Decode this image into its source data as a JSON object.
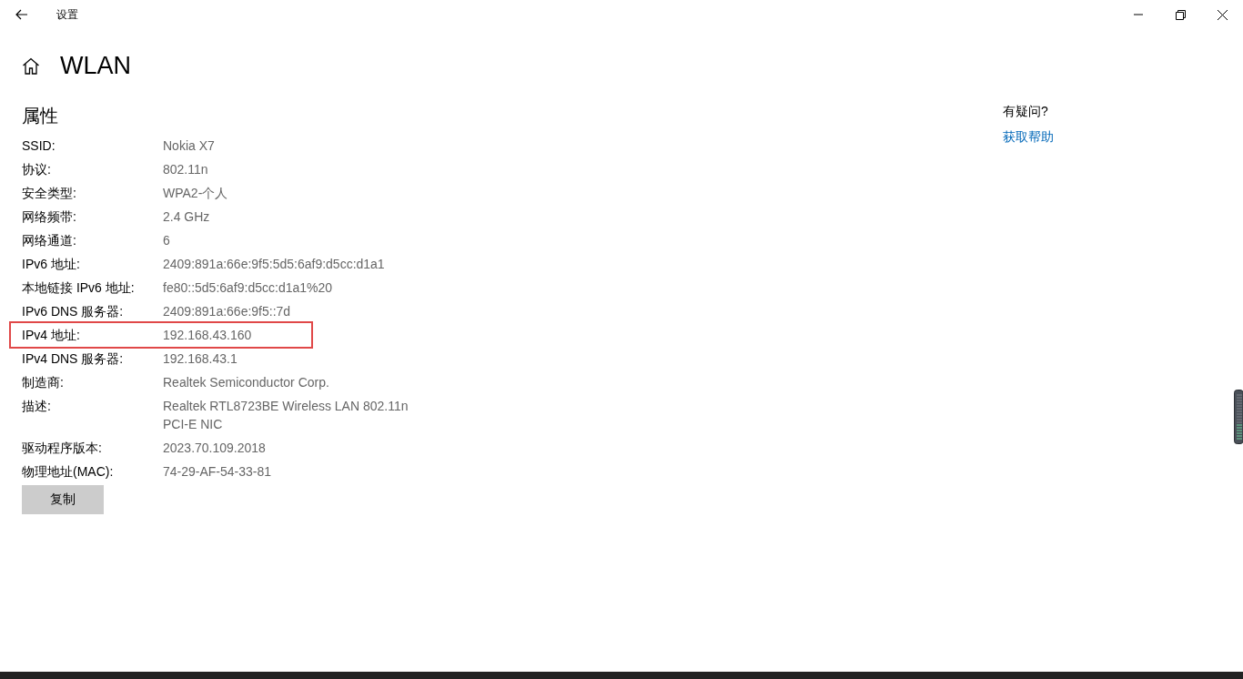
{
  "window": {
    "title": "设置"
  },
  "page": {
    "title": "WLAN"
  },
  "section": {
    "title": "属性"
  },
  "properties": [
    {
      "label": "SSID:",
      "value": [
        "Nokia X7"
      ],
      "highlighted": false
    },
    {
      "label": "协议:",
      "value": [
        "802.11n"
      ],
      "highlighted": false
    },
    {
      "label": "安全类型:",
      "value": [
        "WPA2-个人"
      ],
      "highlighted": false
    },
    {
      "label": "网络频带:",
      "value": [
        "2.4 GHz"
      ],
      "highlighted": false
    },
    {
      "label": "网络通道:",
      "value": [
        "6"
      ],
      "highlighted": false
    },
    {
      "label": "IPv6 地址:",
      "value": [
        "2409:891a:66e:9f5:5d5:6af9:d5cc:d1a1"
      ],
      "highlighted": false
    },
    {
      "label": "本地链接 IPv6 地址:",
      "value": [
        "fe80::5d5:6af9:d5cc:d1a1%20"
      ],
      "highlighted": false
    },
    {
      "label": "IPv6 DNS 服务器:",
      "value": [
        "2409:891a:66e:9f5::7d"
      ],
      "highlighted": false
    },
    {
      "label": "IPv4 地址:",
      "value": [
        "192.168.43.160"
      ],
      "highlighted": true
    },
    {
      "label": "IPv4 DNS 服务器:",
      "value": [
        "192.168.43.1"
      ],
      "highlighted": false
    },
    {
      "label": "制造商:",
      "value": [
        "Realtek Semiconductor Corp."
      ],
      "highlighted": false
    },
    {
      "label": "描述:",
      "value": [
        "Realtek RTL8723BE Wireless LAN 802.11n",
        "PCI-E NIC"
      ],
      "highlighted": false
    },
    {
      "label": "驱动程序版本:",
      "value": [
        "2023.70.109.2018"
      ],
      "highlighted": false
    },
    {
      "label": "物理地址(MAC):",
      "value": [
        "74-29-AF-54-33-81"
      ],
      "highlighted": false
    }
  ],
  "copy_button": {
    "label": "复制"
  },
  "help": {
    "title": "有疑问?",
    "link": "获取帮助"
  }
}
